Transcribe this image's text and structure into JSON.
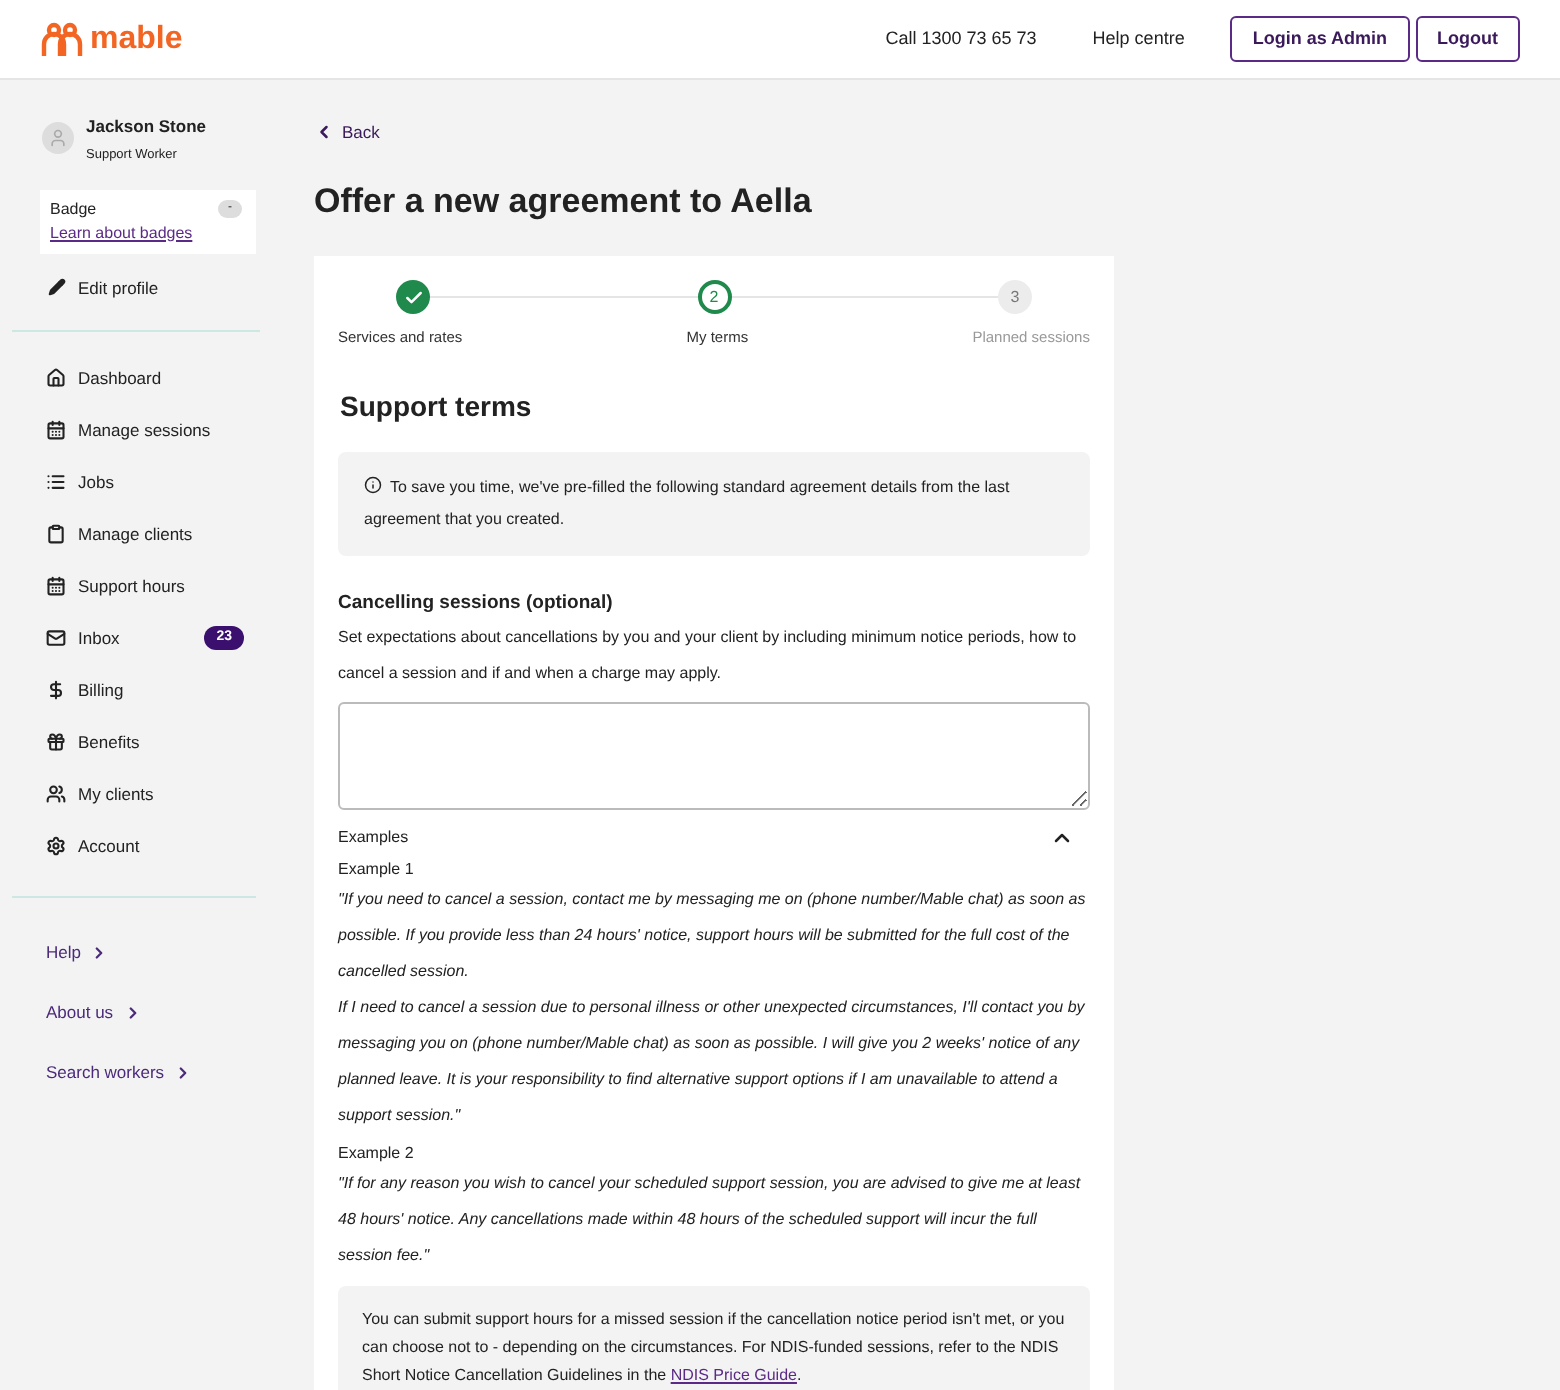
{
  "header": {
    "logo": "mable",
    "phone": "Call 1300 73 65 73",
    "help": "Help centre",
    "buttons": [
      "Login as Admin",
      "Logout"
    ]
  },
  "sidebar": {
    "user": {
      "name": "Jackson Stone",
      "role": "Support Worker"
    },
    "badge": {
      "label": "Badge",
      "count": "-",
      "link": "Learn about badges"
    },
    "edit_profile": "Edit profile",
    "items": [
      {
        "label": "Dashboard"
      },
      {
        "label": "Manage sessions"
      },
      {
        "label": "Jobs"
      },
      {
        "label": "Manage clients"
      },
      {
        "label": "Support hours"
      },
      {
        "label": "Inbox",
        "badge": "23"
      },
      {
        "label": "Billing"
      },
      {
        "label": "Benefits"
      },
      {
        "label": "My clients"
      },
      {
        "label": "Account"
      }
    ],
    "links": [
      "Help",
      "About us",
      "Search workers"
    ]
  },
  "back": "Back",
  "title": "Offer a new agreement to Aella",
  "steps": [
    {
      "label": "Services and rates",
      "kind": "complete"
    },
    {
      "number": "2",
      "label": "My terms",
      "kind": "current"
    },
    {
      "number": "3",
      "label": "Planned sessions",
      "kind": "upcoming"
    }
  ],
  "section_title": "Support terms",
  "info": "To save you time, we've pre-filled the following standard agreement details from the last agreement that you created.",
  "field": {
    "label": "Cancelling sessions (optional)",
    "description": "Set expectations about cancellations by you and your client by including minimum notice periods, how to cancel a session and if and when a charge may apply."
  },
  "examples": {
    "title": "Examples",
    "expanded": true,
    "groups": [
      {
        "heading": "Example 1",
        "paragraphs": [
          "\"If you need to cancel a session, contact me by messaging me on (phone number/Mable chat) as soon as possible. If you provide less than 24 hours' notice, support hours will be submitted for the full cost of the cancelled session.",
          "If I need to cancel a session due to personal illness or other unexpected circumstances, I'll contact you by messaging you on (phone number/Mable chat) as soon as possible. I will give you 2 weeks' notice of any planned leave. It is your responsibility to find alternative support options if I am unavailable to attend a support session.\""
        ]
      },
      {
        "heading": "Example 2",
        "paragraphs": [
          "\"If for any reason you wish to cancel your scheduled support session, you are advised to give me at least 48 hours' notice. Any cancellations made within 48 hours of the scheduled support will incur the full session fee.\""
        ]
      }
    ]
  },
  "note": {
    "text": "You can submit support hours for a missed session if the cancellation notice period isn't met, or you can choose not to - depending on the circumstances. For NDIS-funded sessions, refer to the NDIS Short Notice Cancellation Guidelines in the",
    "link": "NDIS Price Guide",
    "end": "."
  }
}
